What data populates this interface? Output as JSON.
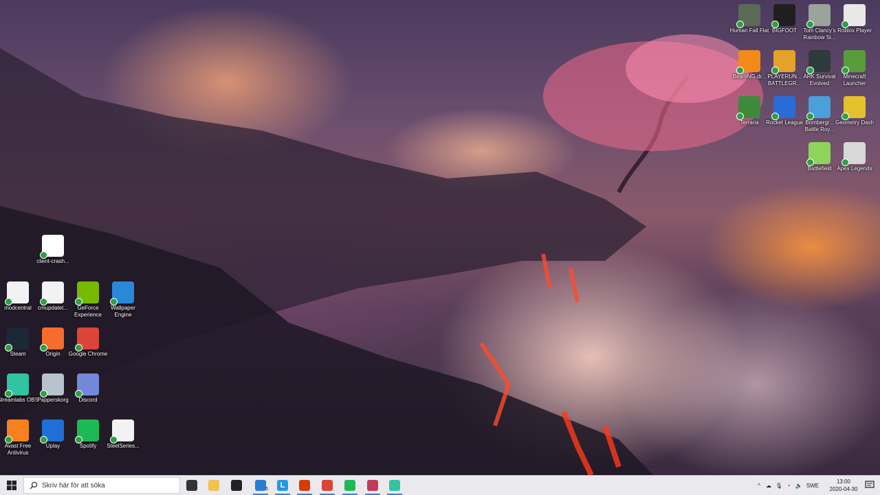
{
  "colors": {
    "taskbar_bg": "#e9e9ee",
    "accent": "#3b7ddd",
    "check_green": "#2ea043"
  },
  "desktop_icons": {
    "top_right": [
      {
        "label": "Human Fall Flat",
        "icon": "human-fall-flat-icon",
        "color": "#5a6b55"
      },
      {
        "label": "BIGFOOT",
        "icon": "bigfoot-icon",
        "color": "#1f1f1f"
      },
      {
        "label": "Tom Clancy's Rainbow Si...",
        "icon": "rainbow-six-icon",
        "color": "#9ca39a"
      },
      {
        "label": "Roblox Player",
        "icon": "roblox-icon",
        "color": "#e8e8e8"
      },
      {
        "label": "BeamNG.dr...",
        "icon": "beamng-icon",
        "color": "#f28a1a"
      },
      {
        "label": "PLAYERUN... BATTLEGR...",
        "icon": "pubg-icon",
        "color": "#e3a22a"
      },
      {
        "label": "ARK Survival Evolved",
        "icon": "ark-icon",
        "color": "#2d3b3a"
      },
      {
        "label": "Minecraft Launcher",
        "icon": "minecraft-icon",
        "color": "#5a9c3a"
      },
      {
        "label": "Terraria",
        "icon": "terraria-icon",
        "color": "#3e8a3a"
      },
      {
        "label": "Rocket League",
        "icon": "rocket-league-icon",
        "color": "#2a6bd6"
      },
      {
        "label": "Bombergr... Battle Roy...",
        "icon": "bombergrounds-icon",
        "color": "#4aa0d8"
      },
      {
        "label": "Geometry Dash",
        "icon": "geometry-dash-icon",
        "color": "#e2c12a"
      },
      {
        "label": "Battlefield",
        "icon": "battlefield-icon",
        "color": "#8fd45a"
      },
      {
        "label": "Apex Legends",
        "icon": "apex-icon",
        "color": "#d8d8d8"
      }
    ],
    "left": [
      {
        "label": "client-crash...",
        "icon": "file-icon",
        "color": "#ffffff"
      },
      {
        "label": "modcentral",
        "icon": "modcentral-icon",
        "color": "#f2f2f2"
      },
      {
        "label": "cmupdatet...",
        "icon": "cmupdater-icon",
        "color": "#f2f2f2"
      },
      {
        "label": "GeForce Experience",
        "icon": "geforce-icon",
        "color": "#76b900"
      },
      {
        "label": "Wallpaper Engine",
        "icon": "wallpaper-engine-icon",
        "color": "#2a88d8"
      },
      {
        "label": "Steam",
        "icon": "steam-icon",
        "color": "#1b2838"
      },
      {
        "label": "Origin",
        "icon": "origin-icon",
        "color": "#f56c2d"
      },
      {
        "label": "Google Chrome",
        "icon": "chrome-icon",
        "color": "#db4437"
      },
      {
        "label": "Streamlabs OBS",
        "icon": "streamlabs-icon",
        "color": "#31c3a2"
      },
      {
        "label": "Papperskorg",
        "icon": "recycle-bin-icon",
        "color": "#b7c3cc"
      },
      {
        "label": "Discord",
        "icon": "discord-icon",
        "color": "#7289da"
      },
      {
        "label": "Avast Free Antivirus",
        "icon": "avast-icon",
        "color": "#f7811e"
      },
      {
        "label": "Uplay",
        "icon": "uplay-icon",
        "color": "#1f6fd6"
      },
      {
        "label": "Spotify",
        "icon": "spotify-icon",
        "color": "#1db954"
      },
      {
        "label": "SteelSeries...",
        "icon": "steelseries-icon",
        "color": "#f2f2f2"
      }
    ]
  },
  "taskbar": {
    "search_placeholder": "Skriv här för att söka",
    "apps": [
      {
        "name": "task-view-button",
        "icon": "task-view-icon",
        "color": "#333333"
      },
      {
        "name": "file-explorer-button",
        "icon": "folder-icon",
        "color": "#f2c14e"
      },
      {
        "name": "store-button",
        "icon": "store-icon",
        "color": "#222222"
      },
      {
        "name": "mail-button",
        "icon": "mail-icon",
        "color": "#2a7bd4",
        "badge": "5"
      },
      {
        "name": "l-app-button",
        "icon": "l-icon",
        "color": "#1e9be0",
        "text": "L"
      },
      {
        "name": "office-button",
        "icon": "office-icon",
        "color": "#d83b01"
      },
      {
        "name": "chrome-button",
        "icon": "chrome-icon",
        "color": "#db4437"
      },
      {
        "name": "spotify-button",
        "icon": "spotify-icon",
        "color": "#1db954"
      },
      {
        "name": "recorder-button",
        "icon": "recorder-icon",
        "color": "#c23a5a"
      },
      {
        "name": "streamlabs-button",
        "icon": "streamlabs-icon",
        "color": "#31c3a2"
      }
    ],
    "language": "SWE",
    "time": "13:00",
    "date": "2020-04-30"
  }
}
